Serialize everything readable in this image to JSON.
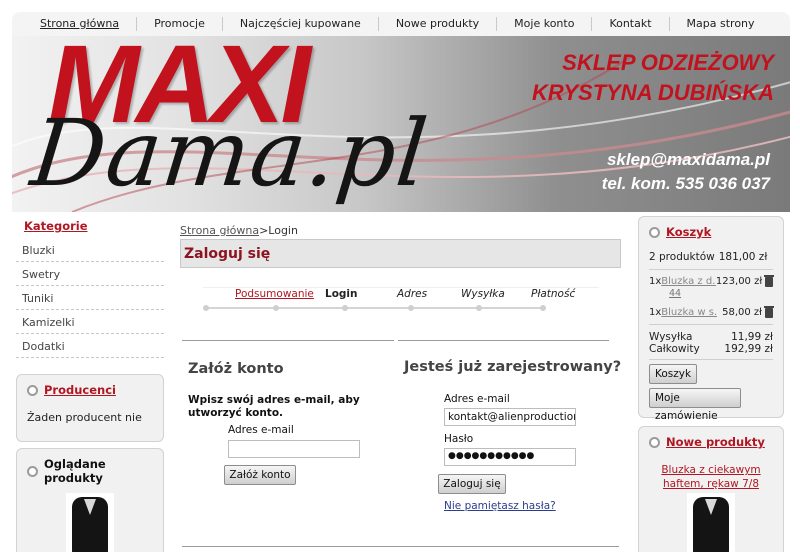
{
  "nav": {
    "items": [
      "Strona główna",
      "Promocje",
      "Najczęściej kupowane",
      "Nowe produkty",
      "Moje konto",
      "Kontakt",
      "Mapa strony"
    ]
  },
  "banner": {
    "logo_top": "MAXI",
    "logo_bottom": "Dama.pl",
    "shop_line1": "SKLEP ODZIEŻOWY",
    "shop_line2": "KRYSTYNA DUBIŃSKA",
    "email": "sklep@maxidama.pl",
    "phone": "tel. kom. 535 036 037"
  },
  "left": {
    "categories_heading": "Kategorie",
    "categories": [
      "Bluzki",
      "Swetry",
      "Tuniki",
      "Kamizelki",
      "Dodatki"
    ],
    "producers_heading": "Producenci",
    "producers_text": "Żaden producent nie",
    "viewed_heading": "Oglądane produkty"
  },
  "center": {
    "breadcrumb_home": "Strona główna",
    "breadcrumb_sep": ">",
    "breadcrumb_current": "Login",
    "title": "Zaloguj się",
    "steps": [
      "Podsumowanie",
      "Login",
      "Adres",
      "Wysyłka",
      "Płatność"
    ],
    "register": {
      "heading": "Załóż konto",
      "note": "Wpisz swój adres e-mail, aby utworzyć konto.",
      "email_label": "Adres e-mail",
      "email_value": "",
      "button": "Załóż konto"
    },
    "login": {
      "heading": "Jesteś już zarejestrowany?",
      "email_label": "Adres e-mail",
      "email_value": "kontakt@alienproduction.co",
      "password_label": "Hasło",
      "password_value": "●●●●●●●●●●●",
      "button": "Zaloguj się",
      "forgot": "Nie pamiętasz hasła?"
    }
  },
  "cart": {
    "heading": "Koszyk",
    "summary_count": "2 produktów",
    "summary_total": "181,00 zł",
    "items": [
      {
        "qty": "1x",
        "name": "Bluzka z d...",
        "price": "123,00 zł"
      },
      {
        "qty": "1x",
        "name": "Bluzka w s...",
        "price": "58,00 zł"
      }
    ],
    "item1_sub": "44",
    "shipping_label": "Wysyłka",
    "shipping_value": "11,99 zł",
    "total_label": "Całkowity",
    "total_value": "192,99 zł",
    "cart_button": "Koszyk",
    "orders_button": "Moje zamówienie"
  },
  "new_products": {
    "heading": "Nowe produkty",
    "item_name": "Bluzka z ciekawym haftem, rękaw 7/8"
  },
  "colors": {
    "brand_red": "#c1121e",
    "link_red": "#b01722",
    "title_red": "#8c1420"
  }
}
